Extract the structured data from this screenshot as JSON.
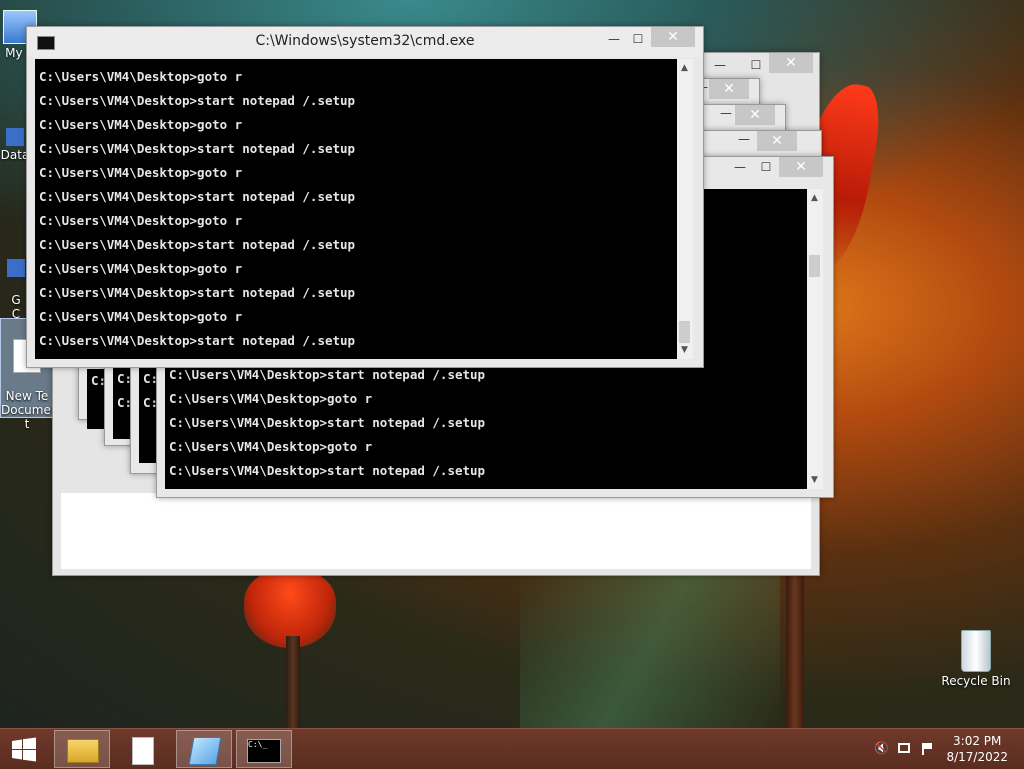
{
  "desktop": {
    "icons": [
      {
        "label": "My C"
      },
      {
        "label": "Data"
      },
      {
        "label": "G\nC"
      },
      {
        "label": "New Te\nDocumen\nt"
      },
      {
        "label": "Recycle Bin"
      }
    ]
  },
  "main_window": {
    "title": "C:\\Windows\\system32\\cmd.exe",
    "lines": [
      "C:\\Users\\VM4\\Desktop>goto r",
      "C:\\Users\\VM4\\Desktop>start notepad /.setup",
      "C:\\Users\\VM4\\Desktop>goto r",
      "C:\\Users\\VM4\\Desktop>start notepad /.setup",
      "C:\\Users\\VM4\\Desktop>goto r",
      "C:\\Users\\VM4\\Desktop>start notepad /.setup",
      "C:\\Users\\VM4\\Desktop>goto r",
      "C:\\Users\\VM4\\Desktop>start notepad /.setup",
      "C:\\Users\\VM4\\Desktop>goto r",
      "C:\\Users\\VM4\\Desktop>start notepad /.setup",
      "C:\\Users\\VM4\\Desktop>goto r",
      "C:\\Users\\VM4\\Desktop>start notepad /.setup"
    ]
  },
  "back_window": {
    "lines": [
      "C:\\Users\\VM4\\Desktop>start notepad /.setup",
      "C:\\Users\\VM4\\Desktop>goto r",
      "C:\\Users\\VM4\\Desktop>start notepad /.setup",
      "C:\\Users\\VM4\\Desktop>goto r",
      "C:\\Users\\VM4\\Desktop>start notepad /.setup"
    ],
    "stack_fragments": [
      "C:",
      "C:",
      "C:",
      "C:",
      "C:"
    ]
  },
  "window_buttons": {
    "minimize": "—",
    "maximize": "☐",
    "close": "✕"
  },
  "taskbar": {
    "time": "3:02 PM",
    "date": "8/17/2022"
  },
  "icons": {
    "start": "windows-logo-icon",
    "explorer": "file-explorer-icon",
    "notepad_doc": "document-icon",
    "notepad": "notepad-icon",
    "cmd": "command-prompt-icon",
    "volume": "volume-muted-icon",
    "network": "network-icon",
    "flag": "action-center-icon"
  },
  "colors": {
    "taskbar": "#5a2c20",
    "console_bg": "#000000",
    "console_fg": "#e6e6e6"
  }
}
